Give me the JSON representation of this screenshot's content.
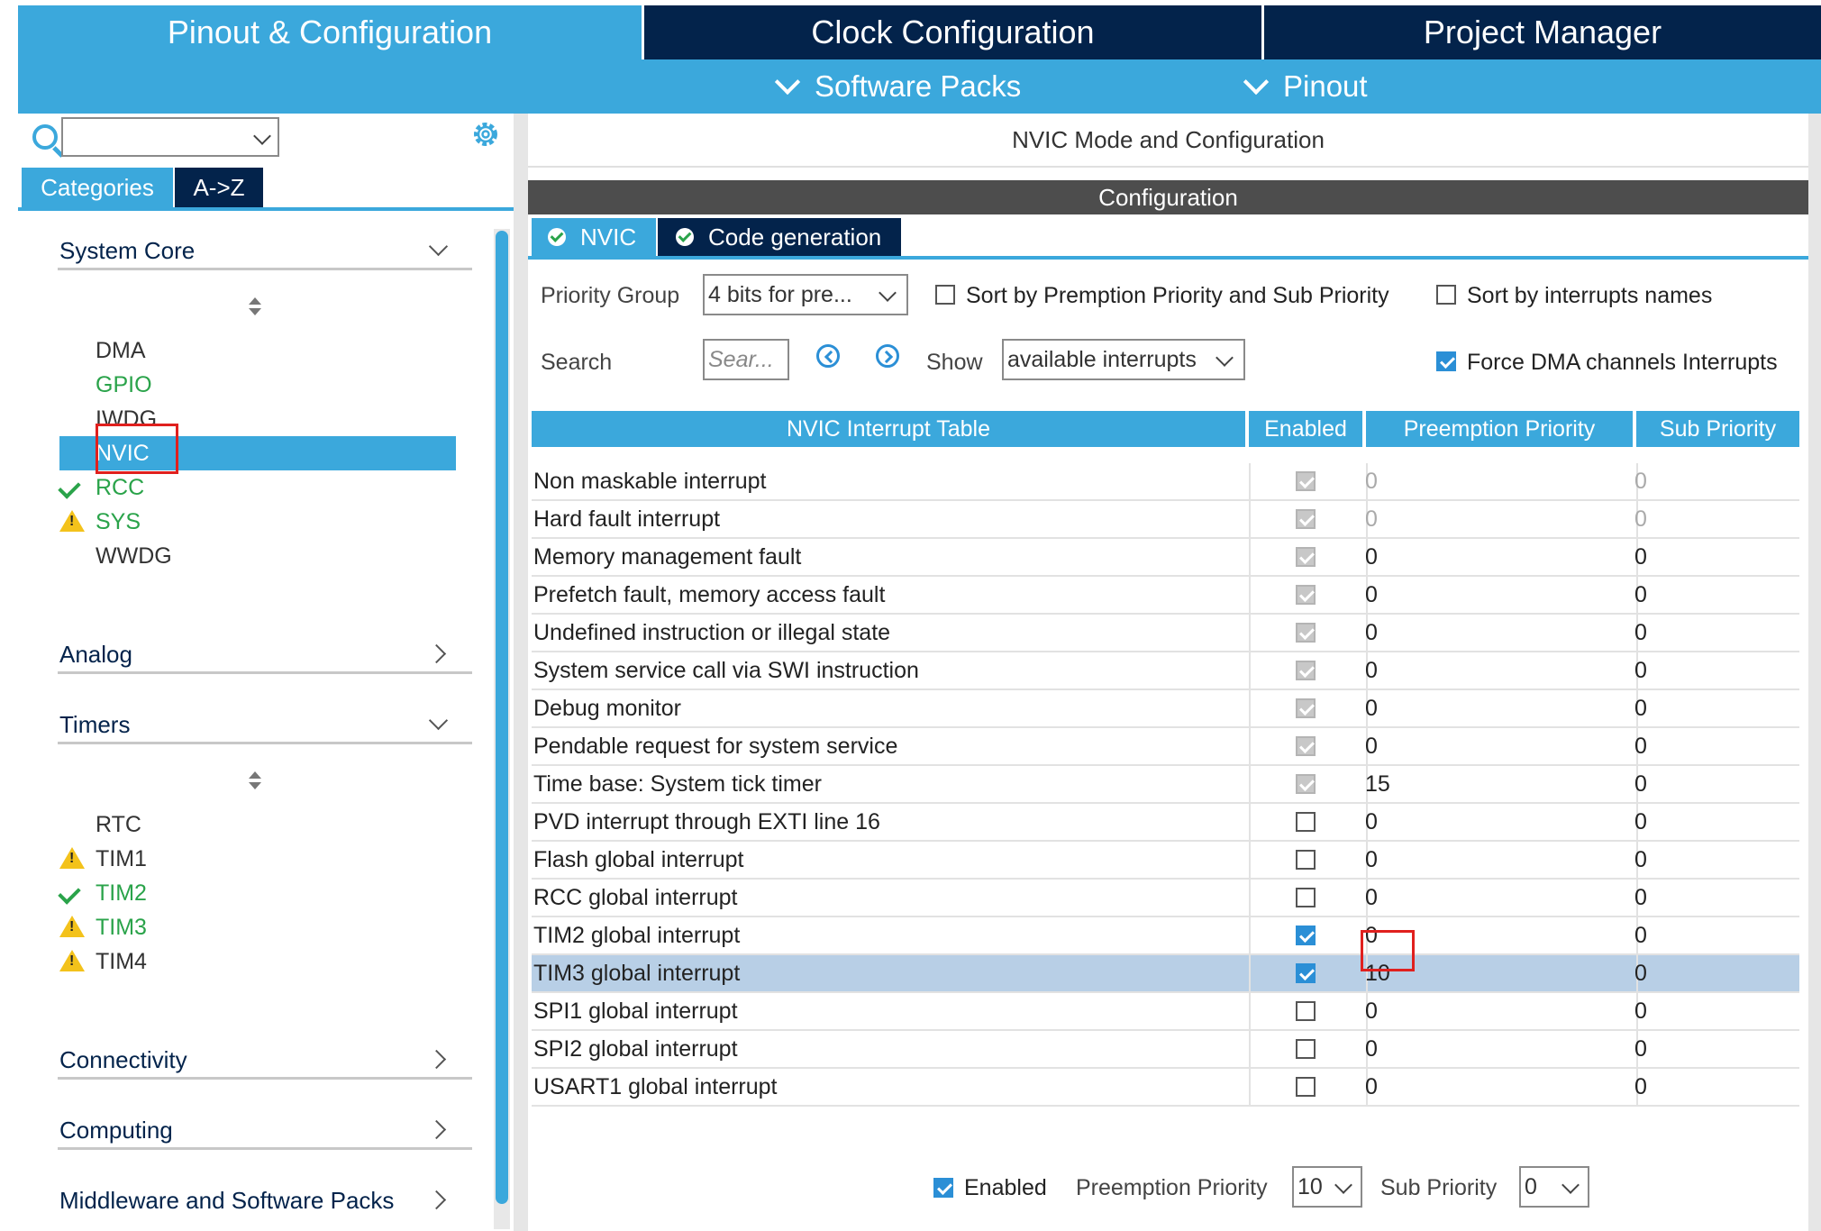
{
  "top_tabs": [
    {
      "label": "Pinout & Configuration",
      "active": true
    },
    {
      "label": "Clock Configuration",
      "active": false
    },
    {
      "label": "Project Manager",
      "active": false
    }
  ],
  "sub_menu": {
    "software_packs": "Software Packs",
    "pinout": "Pinout"
  },
  "left": {
    "search_value": "",
    "tabs": {
      "categories": "Categories",
      "az": "A->Z"
    },
    "system_core": {
      "label": "System Core",
      "items": [
        {
          "label": "DMA",
          "status": "none"
        },
        {
          "label": "GPIO",
          "status": "ok"
        },
        {
          "label": "IWDG",
          "status": "none"
        },
        {
          "label": "NVIC",
          "status": "selected"
        },
        {
          "label": "RCC",
          "status": "ok"
        },
        {
          "label": "SYS",
          "status": "warning"
        },
        {
          "label": "WWDG",
          "status": "none"
        }
      ]
    },
    "analog": "Analog",
    "timers": {
      "label": "Timers",
      "items": [
        {
          "label": "RTC",
          "status": "none"
        },
        {
          "label": "TIM1",
          "status": "warning"
        },
        {
          "label": "TIM2",
          "status": "ok"
        },
        {
          "label": "TIM3",
          "status": "warning"
        },
        {
          "label": "TIM4",
          "status": "warning"
        }
      ]
    },
    "connectivity": "Connectivity",
    "computing": "Computing",
    "middleware": "Middleware and Software Packs"
  },
  "right": {
    "mode_title": "NVIC Mode and Configuration",
    "configuration": "Configuration",
    "tabs": {
      "nvic": "NVIC",
      "code_generation": "Code generation"
    },
    "priority_group_label": "Priority Group",
    "priority_group_value": "4 bits for pre...",
    "sort_priority_label": "Sort by Premption Priority and Sub Priority",
    "sort_names_label": "Sort by interrupts names",
    "search_label": "Search",
    "search_placeholder": "Sear...",
    "show_label": "Show",
    "show_value": "available interrupts",
    "force_dma_label": "Force DMA channels Interrupts",
    "table": {
      "headers": [
        "NVIC Interrupt Table",
        "Enabled",
        "Preemption Priority",
        "Sub Priority"
      ],
      "rows": [
        {
          "name": "Non maskable interrupt",
          "enabled": true,
          "fixed": true,
          "preemption": "0",
          "sub": "0"
        },
        {
          "name": "Hard fault interrupt",
          "enabled": true,
          "fixed": true,
          "preemption": "0",
          "sub": "0"
        },
        {
          "name": "Memory management fault",
          "enabled": true,
          "fixed": false,
          "preemption": "0",
          "sub": "0"
        },
        {
          "name": "Prefetch fault, memory access fault",
          "enabled": true,
          "fixed": false,
          "preemption": "0",
          "sub": "0"
        },
        {
          "name": "Undefined instruction or illegal state",
          "enabled": true,
          "fixed": false,
          "preemption": "0",
          "sub": "0"
        },
        {
          "name": "System service call via SWI instruction",
          "enabled": true,
          "fixed": false,
          "preemption": "0",
          "sub": "0"
        },
        {
          "name": "Debug monitor",
          "enabled": true,
          "fixed": false,
          "preemption": "0",
          "sub": "0"
        },
        {
          "name": "Pendable request for system service",
          "enabled": true,
          "fixed": false,
          "preemption": "0",
          "sub": "0"
        },
        {
          "name": "Time base: System tick timer",
          "enabled": true,
          "fixed": false,
          "preemption": "15",
          "sub": "0"
        },
        {
          "name": "PVD interrupt through EXTI line 16",
          "enabled": false,
          "fixed": false,
          "preemption": "0",
          "sub": "0"
        },
        {
          "name": "Flash global interrupt",
          "enabled": false,
          "fixed": false,
          "preemption": "0",
          "sub": "0"
        },
        {
          "name": "RCC global interrupt",
          "enabled": false,
          "fixed": false,
          "preemption": "0",
          "sub": "0"
        },
        {
          "name": "TIM2 global interrupt",
          "enabled": true,
          "fixed": false,
          "preemption": "0",
          "sub": "0"
        },
        {
          "name": "TIM3 global interrupt",
          "enabled": true,
          "fixed": false,
          "preemption": "10",
          "sub": "0",
          "selected": true
        },
        {
          "name": "SPI1 global interrupt",
          "enabled": false,
          "fixed": false,
          "preemption": "0",
          "sub": "0"
        },
        {
          "name": "SPI2 global interrupt",
          "enabled": false,
          "fixed": false,
          "preemption": "0",
          "sub": "0"
        },
        {
          "name": "USART1 global interrupt",
          "enabled": false,
          "fixed": false,
          "preemption": "0",
          "sub": "0"
        }
      ]
    },
    "bottom": {
      "enabled_label": "Enabled",
      "enabled": true,
      "preemption_label": "Preemption Priority",
      "preemption_value": "10",
      "sub_label": "Sub Priority",
      "sub_value": "0"
    }
  },
  "colors": {
    "accent": "#3ba8dc",
    "navy": "#03234b",
    "selection": "#b8cfe6",
    "highlight": "#e0201e"
  }
}
